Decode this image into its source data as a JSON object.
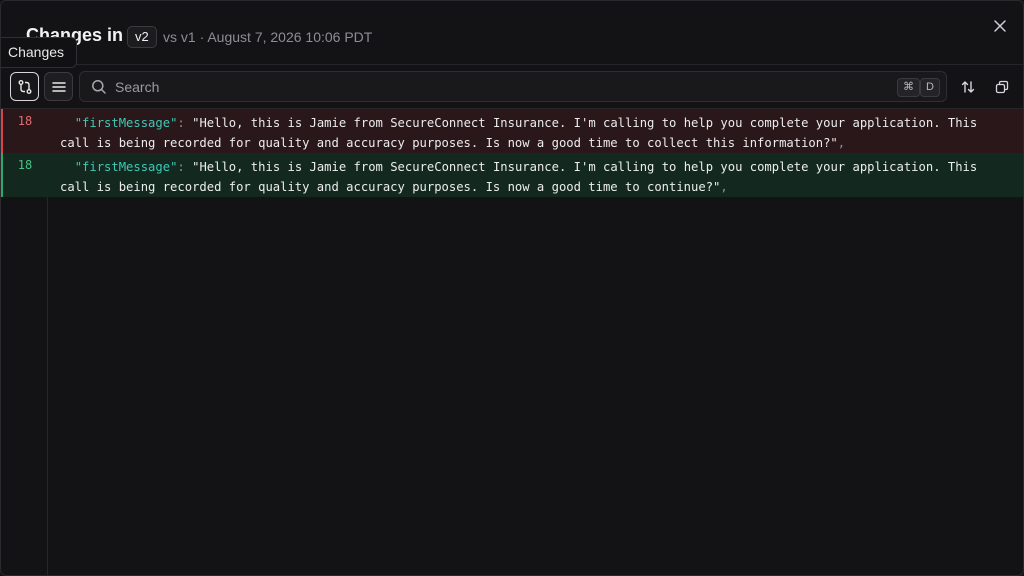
{
  "header": {
    "title": "Changes in",
    "version_badge": "v2",
    "subtitle": "vs v1 · August 7, 2026 10:06 PDT"
  },
  "tooltip": "Changes",
  "toolbar": {
    "search_placeholder": "Search",
    "shortcut_keys": [
      "⌘",
      "D"
    ]
  },
  "diff": {
    "lines": [
      {
        "type": "removed",
        "line_number": "18",
        "key": "\"firstMessage\"",
        "colon": ": ",
        "value": "\"Hello, this is Jamie from SecureConnect Insurance. I'm calling to help you complete your application. This call is being recorded for quality and accuracy purposes. Is now a good time to collect this information?\"",
        "trailing": ","
      },
      {
        "type": "added",
        "line_number": "18",
        "key": "\"firstMessage\"",
        "colon": ": ",
        "value": "\"Hello, this is Jamie from SecureConnect Insurance. I'm calling to help you complete your application. This call is being recorded for quality and accuracy purposes. Is now a good time to continue?\"",
        "trailing": ","
      }
    ]
  },
  "colors": {
    "removed": "#d9434a",
    "added": "#2fa86b",
    "json_key": "#3cc9b7"
  }
}
